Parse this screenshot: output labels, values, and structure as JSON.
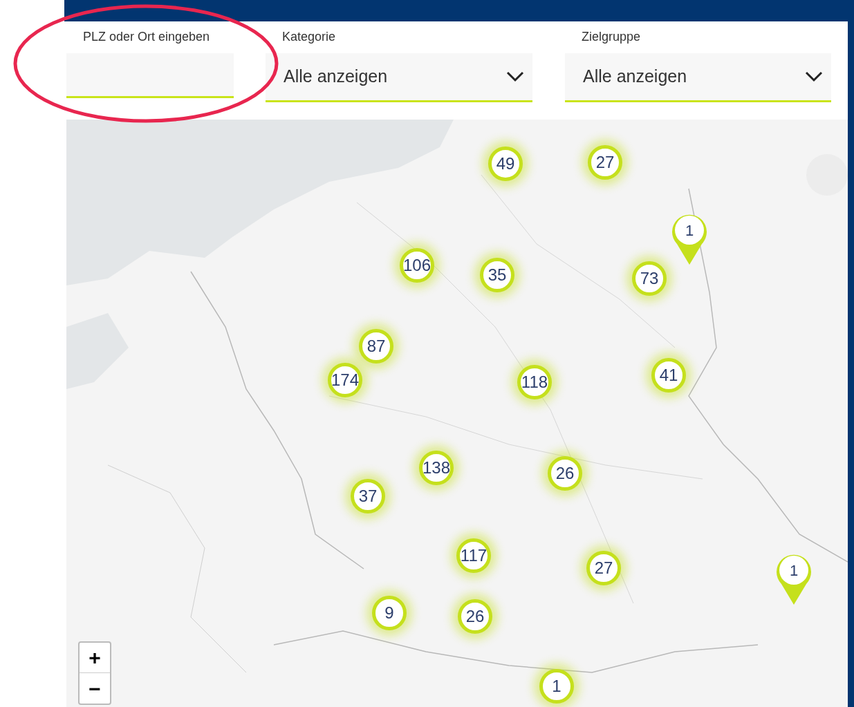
{
  "annotation": {
    "kind": "ellipse"
  },
  "filters": [
    {
      "kind": "text",
      "label": "PLZ oder Ort eingeben"
    },
    {
      "kind": "select",
      "label": "Kategorie",
      "value": "Alle anzeigen"
    },
    {
      "kind": "select",
      "label": "Zielgruppe",
      "value": "Alle anzeigen"
    }
  ],
  "map": {
    "kind": "picture",
    "markers": [
      {
        "kind": "cluster",
        "count": "49"
      },
      {
        "kind": "cluster",
        "count": "27"
      },
      {
        "kind": "pin",
        "count": "1"
      },
      {
        "kind": "cluster",
        "count": "106"
      },
      {
        "kind": "cluster",
        "count": "35"
      },
      {
        "kind": "cluster",
        "count": "73"
      },
      {
        "kind": "cluster",
        "count": "87"
      },
      {
        "kind": "cluster",
        "count": "174"
      },
      {
        "kind": "cluster",
        "count": "118"
      },
      {
        "kind": "cluster",
        "count": "41"
      },
      {
        "kind": "cluster",
        "count": "138"
      },
      {
        "kind": "cluster",
        "count": "26"
      },
      {
        "kind": "cluster",
        "count": "37"
      },
      {
        "kind": "cluster",
        "count": "117"
      },
      {
        "kind": "cluster",
        "count": "27"
      },
      {
        "kind": "pin",
        "count": "1"
      },
      {
        "kind": "cluster",
        "count": "9"
      },
      {
        "kind": "cluster",
        "count": "26"
      },
      {
        "kind": "cluster",
        "count": "1"
      }
    ],
    "zoom_controls": [
      "+",
      "−"
    ]
  }
}
